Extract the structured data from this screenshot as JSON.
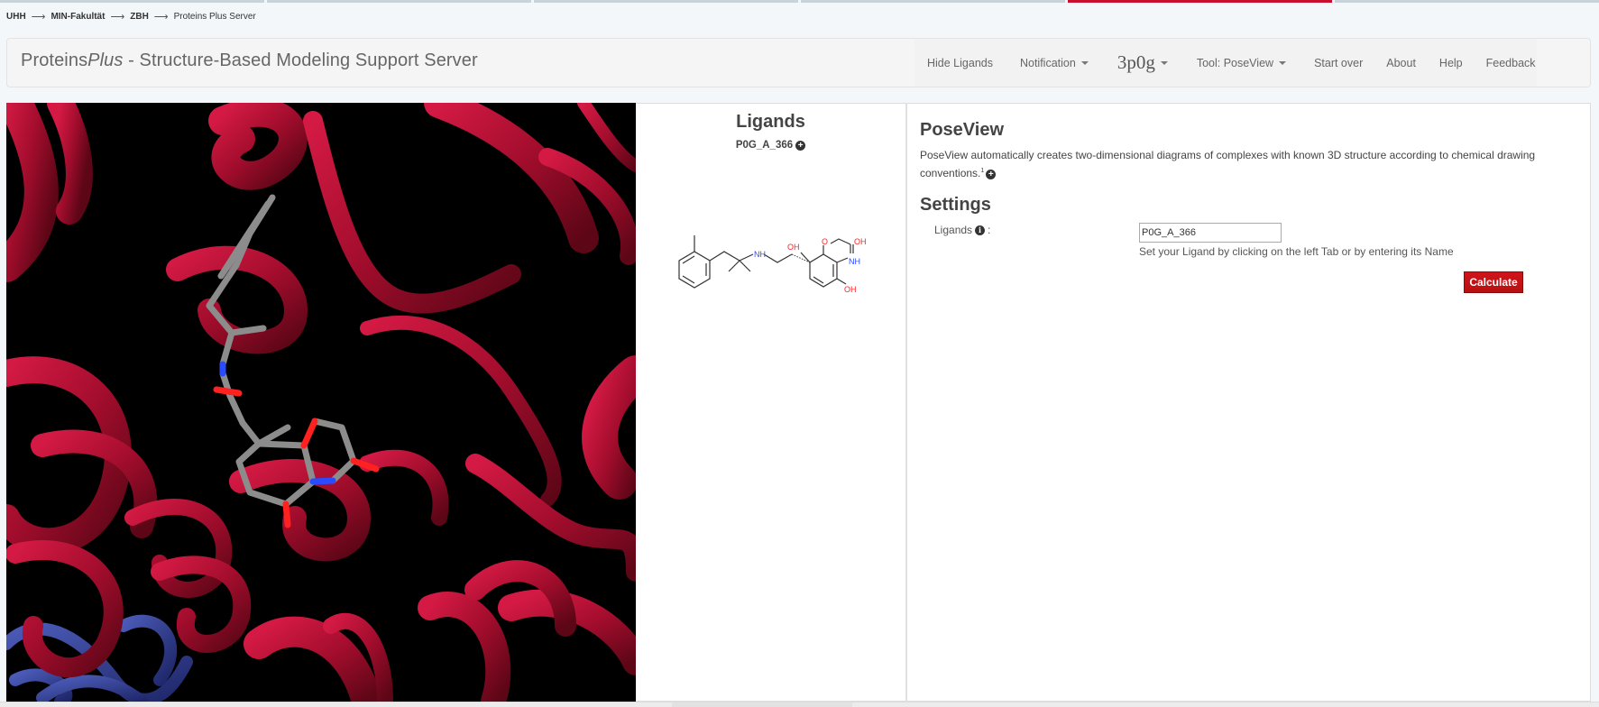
{
  "top_tabs": [
    {
      "active": false
    },
    {
      "active": false
    },
    {
      "active": false
    },
    {
      "active": false
    },
    {
      "active": true
    },
    {
      "active": false
    }
  ],
  "breadcrumb": [
    {
      "label": "UHH"
    },
    {
      "label": "MIN-Fakultät"
    },
    {
      "label": "ZBH"
    },
    {
      "label": "Proteins Plus Server"
    }
  ],
  "breadcrumb_separator": "⟶",
  "navbar": {
    "brand_prefix": "Proteins",
    "brand_italic": "Plus",
    "brand_suffix": " - Structure-Based Modeling Support Server",
    "links": {
      "hide_ligands": "Hide Ligands",
      "notification": "Notification",
      "pdb_code": "3p0g",
      "tool": "Tool: PoseView",
      "start_over": "Start over",
      "about": "About",
      "help": "Help",
      "feedback": "Feedback"
    }
  },
  "ligands_panel": {
    "title": "Ligands",
    "items": [
      {
        "label": "P0G_A_366",
        "icon": "plus-circle-icon"
      }
    ],
    "structure_labels": {
      "nh_amine": "NH",
      "oh_side": "OH",
      "o_ring": "O",
      "oh_top": "OH",
      "nh_ring": "NH",
      "oh_bottom": "OH"
    }
  },
  "tool_panel": {
    "title": "PoseView",
    "description": "PoseView automatically creates two-dimensional diagrams of complexes with known 3D structure according to chemical drawing conventions.",
    "footnote": "1",
    "settings_title": "Settings",
    "ligands_label": "Ligands",
    "ligands_colon": ":",
    "ligand_input_value": "P0G_A_366",
    "ligand_hint": "Set your Ligand by clicking on the left Tab or by entering its Name",
    "calculate_label": "Calculate"
  },
  "colors": {
    "accent_red": "#c8102e",
    "protein_red": "#a30d2d",
    "protein_blue": "#2d3a8c",
    "ligand_grey": "#8c8c8c",
    "oxygen": "#ff2020",
    "nitrogen": "#2a4bff"
  }
}
